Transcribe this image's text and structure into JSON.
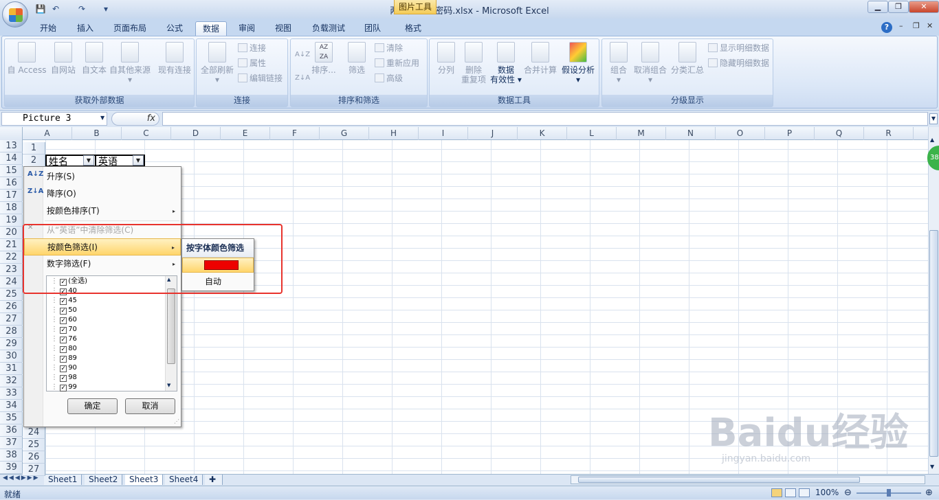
{
  "app": {
    "title": "两小无猜网密码.xlsx - Microsoft Excel",
    "context_tab": "图片工具"
  },
  "quick_access": [
    "💾",
    "↶",
    "↷",
    "▾"
  ],
  "tabs": [
    "开始",
    "插入",
    "页面布局",
    "公式",
    "数据",
    "审阅",
    "视图",
    "负载测试",
    "团队",
    "格式"
  ],
  "active_tab": "数据",
  "ribbon": {
    "get_external": {
      "label": "获取外部数据",
      "buttons": [
        "自 Access",
        "自网站",
        "自文本",
        "自其他来源",
        "现有连接"
      ],
      "arrow": "▾"
    },
    "connections": {
      "label": "连接",
      "refresh": "全部刷新",
      "refresh_arrow": "▾",
      "items": [
        "连接",
        "属性",
        "编辑链接"
      ]
    },
    "sort_filter": {
      "label": "排序和筛选",
      "sort": "排序...",
      "filter": "筛选",
      "items": [
        "清除",
        "重新应用",
        "高级"
      ],
      "az": "A↓Z",
      "za": "Z↓A",
      "azbox": "AZ ZA"
    },
    "data_tools": {
      "label": "数据工具",
      "buttons": [
        "分列",
        "删除",
        "重复项",
        "数据",
        "有效性 ▾",
        "合并计算",
        "假设分析",
        "▾"
      ]
    },
    "outline": {
      "label": "分级显示",
      "buttons": [
        "组合",
        "取消组合",
        "分类汇总"
      ],
      "items": [
        "显示明细数据",
        "隐藏明细数据"
      ],
      "arrow": "▾"
    }
  },
  "formula_bar": {
    "name_box": "Picture 3",
    "fx": "fx"
  },
  "columns": [
    "A",
    "B",
    "C",
    "D",
    "E",
    "F",
    "G",
    "H",
    "I",
    "J",
    "K",
    "L",
    "M",
    "N",
    "O",
    "P",
    "Q",
    "R"
  ],
  "row_numbers": [
    "13",
    "14",
    "15",
    "16",
    "17",
    "18",
    "19",
    "20",
    "21",
    "22",
    "23",
    "24",
    "25",
    "26",
    "27",
    "28",
    "29",
    "30",
    "31",
    "32",
    "33",
    "34",
    "35",
    "36",
    "37",
    "38",
    "39"
  ],
  "inner_rows": [
    "1",
    "2",
    "24",
    "25",
    "26",
    "27"
  ],
  "cells": {
    "a2": "姓名",
    "b2": "英语"
  },
  "filter_menu": {
    "items": [
      {
        "label": "升序(S)",
        "icon": "A↓Z"
      },
      {
        "label": "降序(O)",
        "icon": "Z↓A"
      },
      {
        "label": "按颜色排序(T)",
        "arrow": "▸"
      },
      {
        "label": "从“英语”中清除筛选(C)",
        "icon": "✕",
        "disabled": true
      },
      {
        "label": "按颜色筛选(I)",
        "arrow": "▸"
      },
      {
        "label": "数字筛选(F)",
        "arrow": "▸"
      }
    ],
    "list": [
      "(全选)",
      "40",
      "45",
      "50",
      "60",
      "70",
      "76",
      "80",
      "89",
      "90",
      "98",
      "99"
    ],
    "ok": "确定",
    "cancel": "取消"
  },
  "submenu": {
    "title": "按字体颜色筛选",
    "swatch_color": "#ee0000",
    "auto": "自动"
  },
  "sheet_tabs": [
    "Sheet1",
    "Sheet2",
    "Sheet3",
    "Sheet4"
  ],
  "active_sheet": "Sheet3",
  "status": {
    "ready": "就绪",
    "zoom": "100%"
  },
  "side_badge": "38",
  "watermark": "Baidu经验",
  "watermark_sub": "jingyan.baidu.com"
}
